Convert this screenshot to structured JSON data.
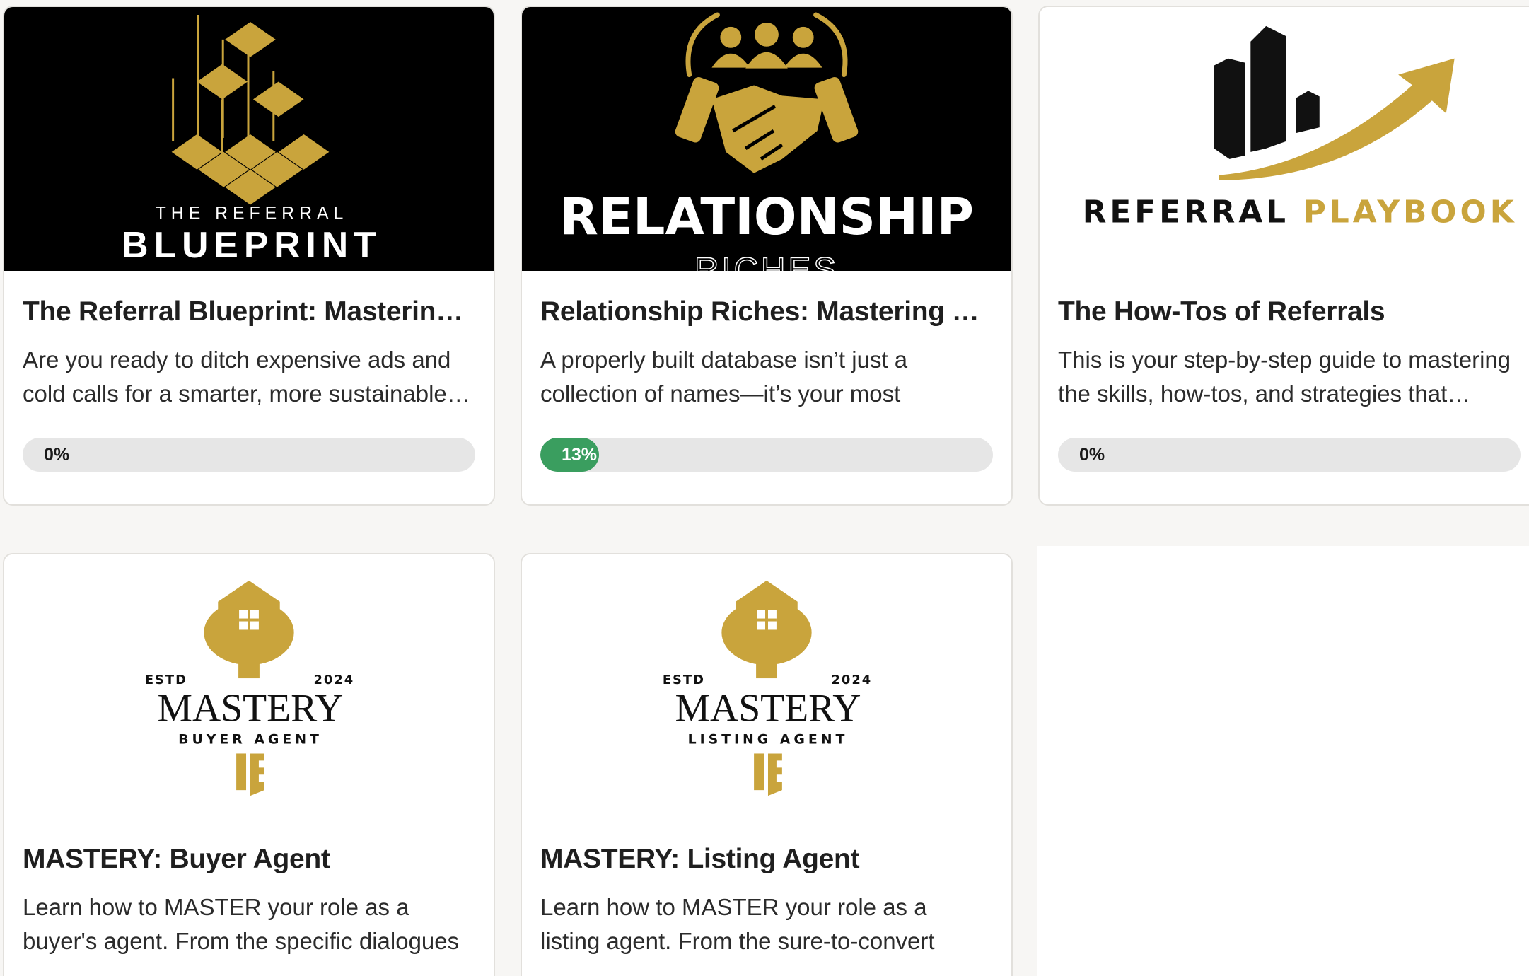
{
  "colors": {
    "gold": "#c9a43c",
    "progress_fill": "#3a9e5f",
    "progress_track": "#e6e6e6",
    "card_border": "#e2e0dc"
  },
  "courses": [
    {
      "thumb": {
        "line1": "THE REFERRAL",
        "line2": "BLUEPRINT"
      },
      "title": "The Referral Blueprint: Mastering …",
      "description": "Are you ready to ditch expensive ads and cold calls for a smarter, more sustainable…",
      "progress_percent": 0,
      "progress_label": "0%"
    },
    {
      "thumb": {
        "line1": "RELATIONSHIP",
        "line2": "RICHES"
      },
      "title": "Relationship Riches: Mastering Y…",
      "description": "A properly built database isn’t just a collection of names—it’s your most valuable…",
      "progress_percent": 13,
      "progress_label": "13%"
    },
    {
      "thumb": {
        "word1": "REFERRAL",
        "word2": "PLAYBOOK"
      },
      "title": "The How-Tos of Referrals",
      "description": "This is your step-by-step guide to mastering the skills, how-tos, and strategies that…",
      "progress_percent": 0,
      "progress_label": "0%"
    },
    {
      "thumb": {
        "estd": "ESTD",
        "year": "2024",
        "main": "MASTERY",
        "sub": "BUYER AGENT"
      },
      "title": "MASTERY: Buyer Agent",
      "description": "Learn how to MASTER your role as a buyer's agent. From the specific dialogues to…"
    },
    {
      "thumb": {
        "estd": "ESTD",
        "year": "2024",
        "main": "MASTERY",
        "sub": "LISTING AGENT"
      },
      "title": "MASTERY: Listing Agent",
      "description": "Learn how to MASTER your role as a listing agent. From the sure-to-convert listing…"
    }
  ]
}
